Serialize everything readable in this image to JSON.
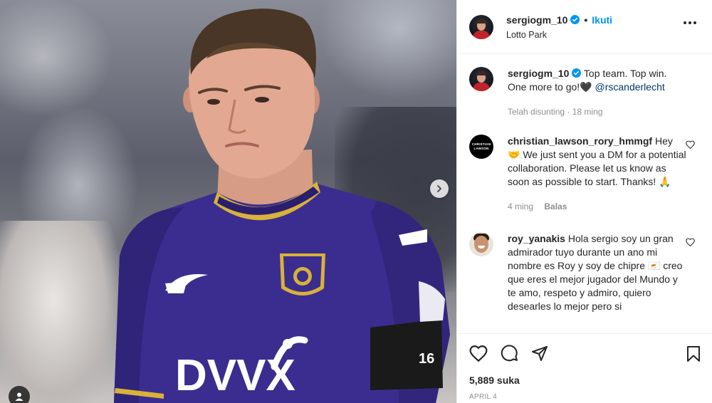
{
  "post": {
    "username": "sergiogm_10",
    "follow_label": "Ikuti",
    "location": "Lotto Park",
    "caption_text": "Top team. Top win. One more to go!🖤",
    "caption_mention": "@rscanderlecht",
    "caption_meta": "Telah disunting · 18 ming",
    "jersey_number": "16",
    "sponsor_text": "DVVX"
  },
  "comments": [
    {
      "username": "christian_lawson_rory_hmmgf",
      "avatar_text_1": "CHRISTIAN",
      "avatar_text_2": "LAWSON",
      "text": "Hey 🤝 We just sent you a DM for a potential collaboration. Please let us know as soon as possible to start. Thanks! 🙏",
      "time": "4 ming",
      "reply_label": "Balas"
    },
    {
      "username": "roy_yanakis",
      "text": "Hola sergio soy un gran admirador tuyo durante un ano mi nombre es Roy y soy de chipre 🇨🇾 creo que eres el mejor jugador del Mundo y te amo, respeto y admiro, quiero desearles lo mejor pero si"
    }
  ],
  "footer": {
    "likes": "5,889 suka",
    "date": "APRIL 4"
  },
  "colors": {
    "link": "#0095f6",
    "mention": "#00376b",
    "jersey": "#3b2d8f",
    "trim": "#d8b23a"
  },
  "icons": [
    "verified-icon",
    "more-icon",
    "heart-icon",
    "comment-icon",
    "share-icon",
    "bookmark-icon",
    "next-arrow-icon",
    "user-tag-icon"
  ]
}
